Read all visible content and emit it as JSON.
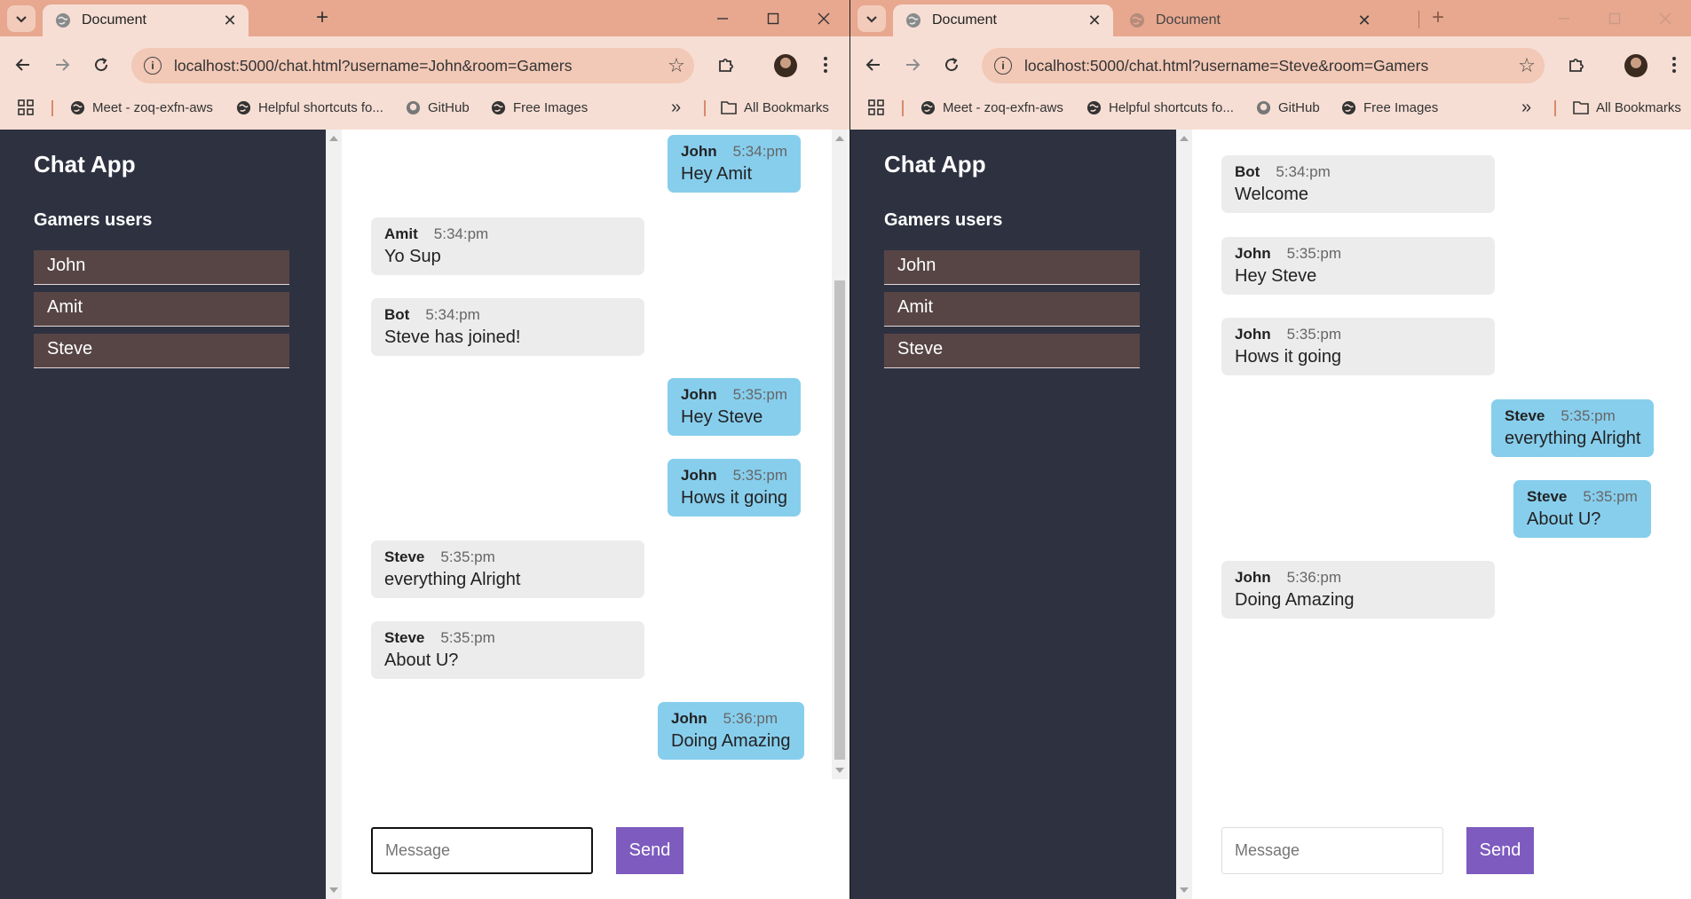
{
  "left": {
    "tabs": [
      {
        "title": "Document"
      }
    ],
    "url": "localhost:5000/chat.html?username=John&room=Gamers",
    "app": {
      "title": "Chat App",
      "users_heading": "Gamers users",
      "users": [
        "John",
        "Amit",
        "Steve"
      ]
    },
    "messages": [
      {
        "author": "John",
        "time": "5:34:pm",
        "text": "Hey Amit",
        "mine": true
      },
      {
        "author": "Amit",
        "time": "5:34:pm",
        "text": "Yo Sup",
        "mine": false
      },
      {
        "author": "Bot",
        "time": "5:34:pm",
        "text": "Steve has joined!",
        "mine": false
      },
      {
        "author": "John",
        "time": "5:35:pm",
        "text": "Hey Steve",
        "mine": true
      },
      {
        "author": "John",
        "time": "5:35:pm",
        "text": "Hows it going",
        "mine": true
      },
      {
        "author": "Steve",
        "time": "5:35:pm",
        "text": "everything Alright",
        "mine": false
      },
      {
        "author": "Steve",
        "time": "5:35:pm",
        "text": "About U?",
        "mine": false
      },
      {
        "author": "John",
        "time": "5:36:pm",
        "text": "Doing Amazing",
        "mine": true
      }
    ],
    "input_placeholder": "Message",
    "send_label": "Send"
  },
  "right": {
    "tabs": [
      {
        "title": "Document"
      },
      {
        "title": "Document"
      }
    ],
    "url": "localhost:5000/chat.html?username=Steve&room=Gamers",
    "app": {
      "title": "Chat App",
      "users_heading": "Gamers users",
      "users": [
        "John",
        "Amit",
        "Steve"
      ]
    },
    "messages": [
      {
        "author": "Bot",
        "time": "5:34:pm",
        "text": "Welcome",
        "mine": false
      },
      {
        "author": "John",
        "time": "5:35:pm",
        "text": "Hey Steve",
        "mine": false
      },
      {
        "author": "John",
        "time": "5:35:pm",
        "text": "Hows it going",
        "mine": false
      },
      {
        "author": "Steve",
        "time": "5:35:pm",
        "text": "everything Alright",
        "mine": true
      },
      {
        "author": "Steve",
        "time": "5:35:pm",
        "text": "About U?",
        "mine": true
      },
      {
        "author": "John",
        "time": "5:36:pm",
        "text": "Doing Amazing",
        "mine": false
      }
    ],
    "input_placeholder": "Message",
    "send_label": "Send"
  },
  "bookmarks": [
    {
      "label": "Meet - zoq-exfn-aws",
      "icon": "globe-icon"
    },
    {
      "label": "Helpful shortcuts fo...",
      "icon": "globe-icon"
    },
    {
      "label": "GitHub",
      "icon": "github-icon"
    },
    {
      "label": "Free Images",
      "icon": "globe-icon"
    }
  ],
  "all_bookmarks_label": "All Bookmarks",
  "colors": {
    "tabstrip": "#e7a88f",
    "toolbar": "#f6ded4",
    "sidebar": "#2e3140",
    "user_item": "#574546",
    "my_bubble": "#87ceed",
    "other_bubble": "#ececec",
    "send_button": "#7d5bbf"
  }
}
